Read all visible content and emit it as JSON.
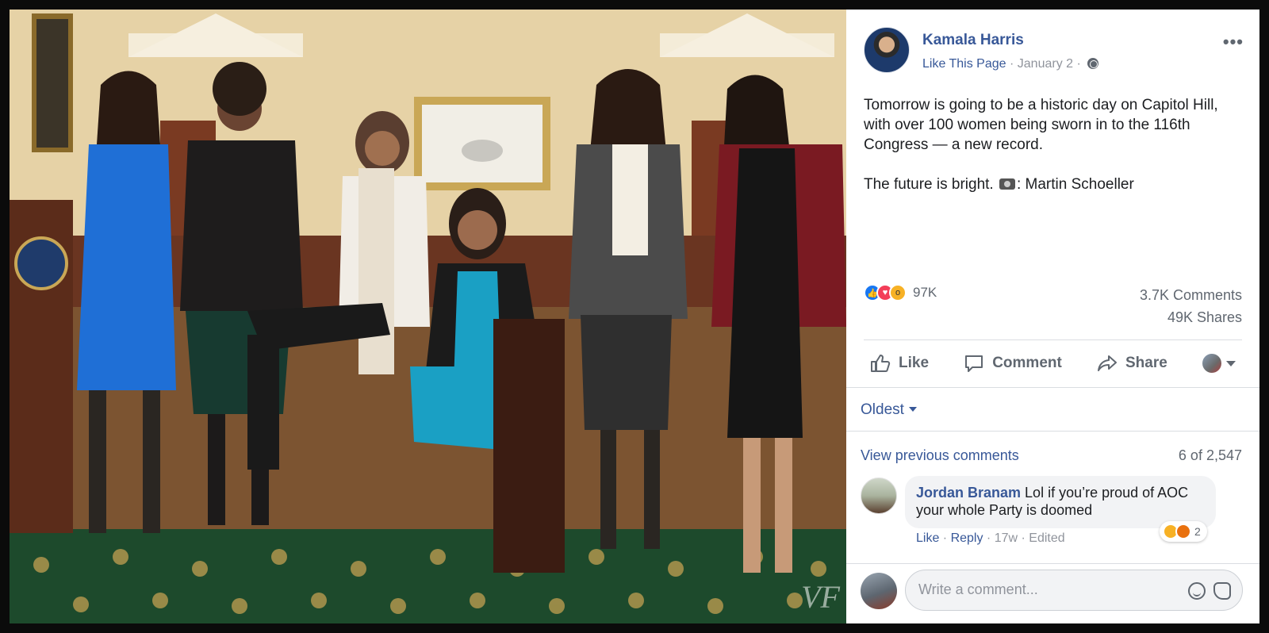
{
  "post": {
    "page_name": "Kamala Harris",
    "like_page": "Like This Page",
    "date_meta": " · January 2 · ",
    "text_p1": "Tomorrow is going to be a historic day on Capitol Hill, with over 100 women being sworn in to the 116th Congress — a new record.",
    "text_p2_before": "The future is bright. ",
    "text_p2_after": ": Martin Schoeller"
  },
  "stats": {
    "reactions": "97K",
    "comments": "3.7K Comments",
    "shares": "49K Shares"
  },
  "actions": {
    "like": "Like",
    "comment": "Comment",
    "share": "Share"
  },
  "comments": {
    "sort": "Oldest",
    "view_previous": "View previous comments",
    "count": "6 of 2,547",
    "items": [
      {
        "author": "Jordan Branam",
        "text": " Lol if you’re proud of AOC your whole Party is doomed",
        "like": "Like",
        "reply": "Reply",
        "meta": " · 17w · Edited",
        "reaction_count": "2"
      }
    ]
  },
  "composer": {
    "placeholder": "Write a comment..."
  },
  "photo": {
    "watermark": "VF"
  }
}
